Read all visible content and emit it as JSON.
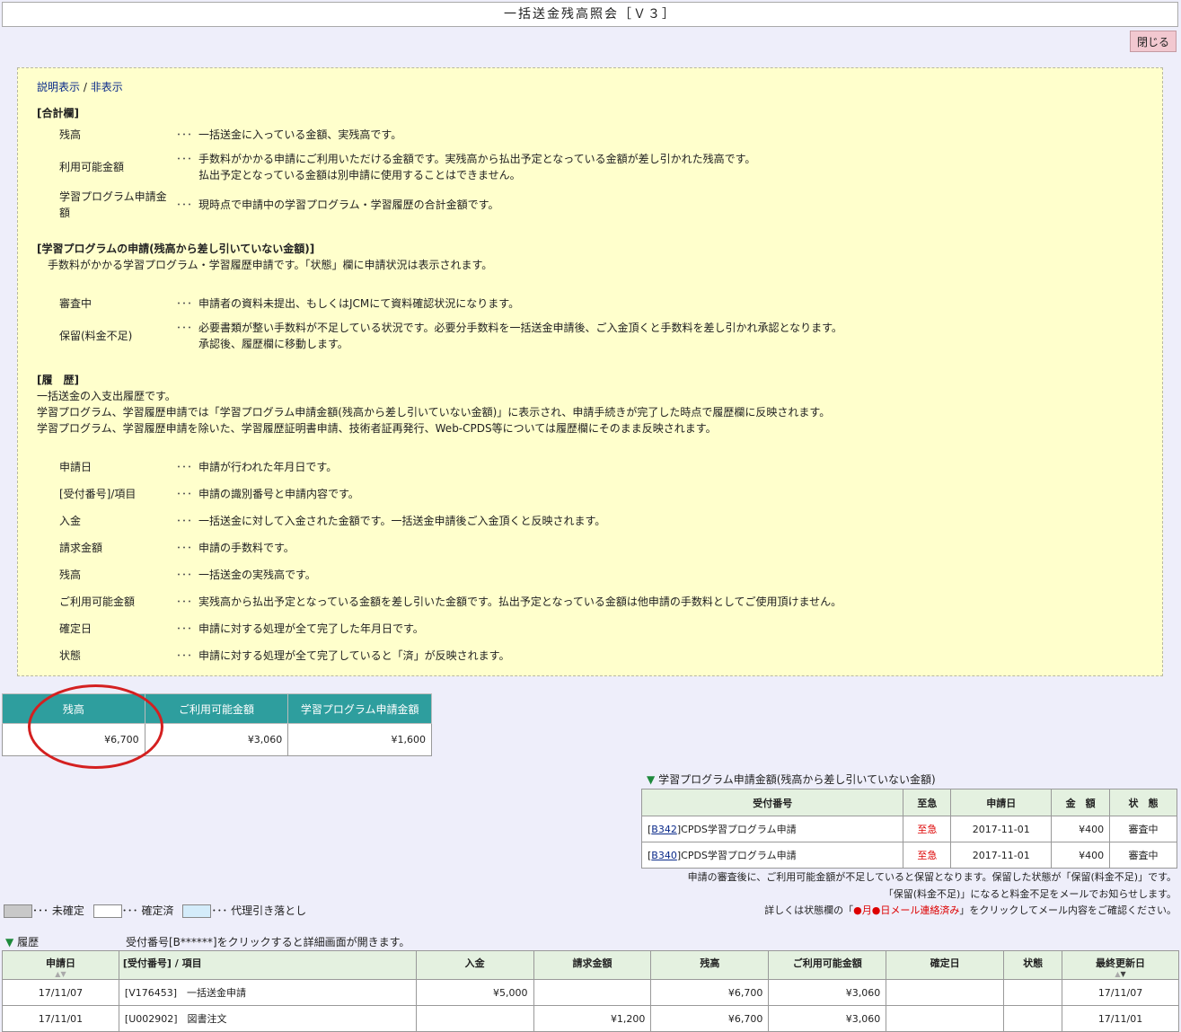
{
  "window": {
    "title": "一括送金残高照会［Ｖ３］"
  },
  "close_label": "閉じる",
  "help": {
    "toggle_show": "説明表示",
    "toggle_sep": "/",
    "toggle_hide": "非表示",
    "total_heading": "[合計欄]",
    "total_items": [
      {
        "term": "残高",
        "desc": "一括送金に入っている金額、実残高です。"
      },
      {
        "term": "利用可能金額",
        "desc": "手数料がかかる申請にご利用いただける金額です。実残高から払出予定となっている金額が差し引かれた残高です。",
        "desc2": "払出予定となっている金額は別申請に使用することはできません。"
      },
      {
        "term": "学習プログラム申請金",
        "term2": "額",
        "desc": "現時点で申請中の学習プログラム・学習履歴の合計金額です。"
      }
    ],
    "program_heading": "[学習プログラムの申請(残高から差し引いていない金額)]",
    "program_sub": "手数料がかかる学習プログラム・学習履歴申請です。「状態」欄に申請状況は表示されます。",
    "program_items": [
      {
        "term": "審査中",
        "desc": "申請者の資料未提出、もしくはJCMにて資料確認状況になります。"
      },
      {
        "term": "保留(料金不足)",
        "desc": "必要書類が整い手数料が不足している状況です。必要分手数料を一括送金申請後、ご入金頂くと手数料を差し引かれ承認となります。",
        "desc2": "承認後、履歴欄に移動します。"
      }
    ],
    "history_heading": "[履　歴]",
    "history_lines": [
      "一括送金の入支出履歴です。",
      "学習プログラム、学習履歴申請では「学習プログラム申請金額(残高から差し引いていない金額)」に表示され、申請手続きが完了した時点で履歴欄に反映されます。",
      "学習プログラム、学習履歴申請を除いた、学習履歴証明書申請、技術者証再発行、Web-CPDS等については履歴欄にそのまま反映されます。"
    ],
    "history_items": [
      {
        "term": "申請日",
        "desc": "申請が行われた年月日です。"
      },
      {
        "term": "[受付番号]/項目",
        "desc": "申請の識別番号と申請内容です。"
      },
      {
        "term": "入金",
        "desc": "一括送金に対して入金された金額です。一括送金申請後ご入金頂くと反映されます。"
      },
      {
        "term": "請求金額",
        "desc": "申請の手数料です。"
      },
      {
        "term": "残高",
        "desc": "一括送金の実残高です。"
      },
      {
        "term": "ご利用可能金額",
        "desc": "実残高から払出予定となっている金額を差し引いた金額です。払出予定となっている金額は他申請の手数料としてご使用頂けません。"
      },
      {
        "term": "確定日",
        "desc": "申請に対する処理が全て完了した年月日です。"
      },
      {
        "term": "状態",
        "desc": "申請に対する処理が全て完了していると「済」が反映されます。"
      }
    ],
    "dots": "･･･"
  },
  "summary": {
    "headers": [
      "残高",
      "ご利用可能金額",
      "学習プログラム申請金額"
    ],
    "values": [
      "¥6,700",
      "¥3,060",
      "¥1,600"
    ]
  },
  "program": {
    "tri": "▼",
    "title": "学習プログラム申請金額(残高から差し引いていない金額)",
    "headers": [
      "受付番号",
      "至急",
      "申請日",
      "金　額",
      "状　態"
    ],
    "rows": [
      {
        "id": "B342",
        "label": "CPDS学習プログラム申請",
        "urgent": "至急",
        "date": "2017-11-01",
        "amount": "¥400",
        "status": "審査中"
      },
      {
        "id": "B340",
        "label": "CPDS学習プログラム申請",
        "urgent": "至急",
        "date": "2017-11-01",
        "amount": "¥400",
        "status": "審査中"
      }
    ],
    "note1": "申請の審査後に、ご利用可能金額が不足していると保留となります。保留した状態が「保留(料金不足)」です。",
    "note2": "「保留(料金不足)」になると料金不足をメールでお知らせします。",
    "note3_pre": "詳しくは状態欄の「",
    "note3_red": "●月●日メール連絡済み",
    "note3_post": "」をクリックしてメール内容をご確認ください。"
  },
  "legend": {
    "gray_color": "#c8c8c8",
    "white_color": "#ffffff",
    "blue_color": "#d4ecfa",
    "unconfirmed": "･･･ 未確定",
    "confirmed": "･･･ 確定済",
    "proxy": "･･･ 代理引き落とし"
  },
  "history": {
    "tri": "▼",
    "title": "履歴",
    "hint": "受付番号[B******]をクリックすると詳細画面が開きます。",
    "headers": [
      "申請日",
      "[受付番号] / 項目",
      "入金",
      "請求金額",
      "残高",
      "ご利用可能金額",
      "確定日",
      "状態",
      "最終更新日"
    ],
    "rows": [
      {
        "date": "17/11/07",
        "item": "[V176453]　一括送金申請",
        "deposit": "¥5,000",
        "charge": "",
        "balance": "¥6,700",
        "available": "¥3,060",
        "confirmed": "",
        "status": "",
        "updated": "17/11/07"
      },
      {
        "date": "17/11/01",
        "item": "[U002902]　図書注文",
        "deposit": "",
        "charge": "¥1,200",
        "balance": "¥6,700",
        "available": "¥3,060",
        "confirmed": "",
        "status": "",
        "updated": "17/11/01"
      }
    ]
  }
}
